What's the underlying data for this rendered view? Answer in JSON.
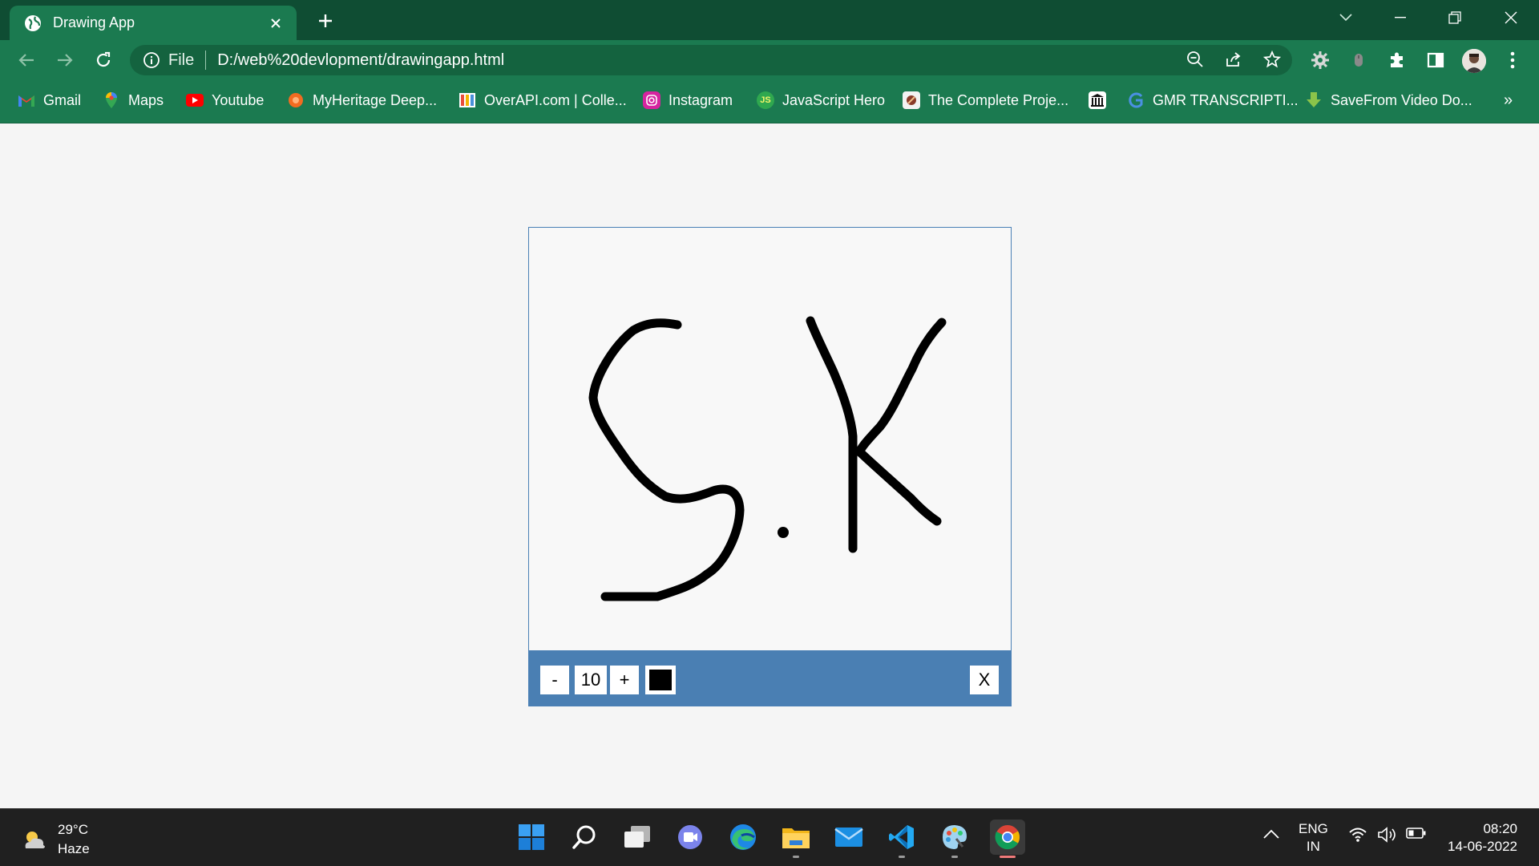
{
  "browser": {
    "tab": {
      "title": "Drawing App",
      "favicon": "globe-icon"
    },
    "address": {
      "scheme": "File",
      "url": "D:/web%20devlopment/drawingapp.html"
    },
    "bookmarks": [
      {
        "label": "Gmail",
        "icon": "gmail-icon"
      },
      {
        "label": "Maps",
        "icon": "maps-icon"
      },
      {
        "label": "Youtube",
        "icon": "youtube-icon"
      },
      {
        "label": "MyHeritage Deep...",
        "icon": "myheritage-icon"
      },
      {
        "label": "OverAPI.com | Colle...",
        "icon": "overapi-icon"
      },
      {
        "label": "Instagram",
        "icon": "instagram-icon"
      },
      {
        "label": "JavaScript Hero",
        "icon": "js-icon"
      },
      {
        "label": "The Complete Proje...",
        "icon": "project-icon"
      },
      {
        "label": "",
        "icon": "museum-icon"
      },
      {
        "label": "GMR TRANSCRIPTI...",
        "icon": "gmr-icon"
      },
      {
        "label": "SaveFrom Video Do...",
        "icon": "savefrom-icon"
      }
    ],
    "overflow": "»"
  },
  "app": {
    "decrease_label": "-",
    "size_value": "10",
    "increase_label": "+",
    "color": "#000000",
    "clear_label": "X",
    "canvas_drawing": "S.K"
  },
  "taskbar": {
    "weather": {
      "temp": "29°C",
      "condition": "Haze"
    },
    "apps": [
      "windows-start-icon",
      "search-icon",
      "task-view-icon",
      "chat-icon",
      "edge-icon",
      "file-explorer-icon",
      "mail-icon",
      "vscode-icon",
      "paint-icon",
      "chrome-icon"
    ],
    "language": {
      "line1": "ENG",
      "line2": "IN"
    },
    "clock": {
      "time": "08:20",
      "date": "14-06-2022"
    }
  },
  "colors": {
    "tabstrip": "#0f4d33",
    "toolbar": "#1b7a50",
    "app_toolbar": "#4a7fb3",
    "page_bg": "#f5f5f5",
    "taskbar": "#202020"
  }
}
